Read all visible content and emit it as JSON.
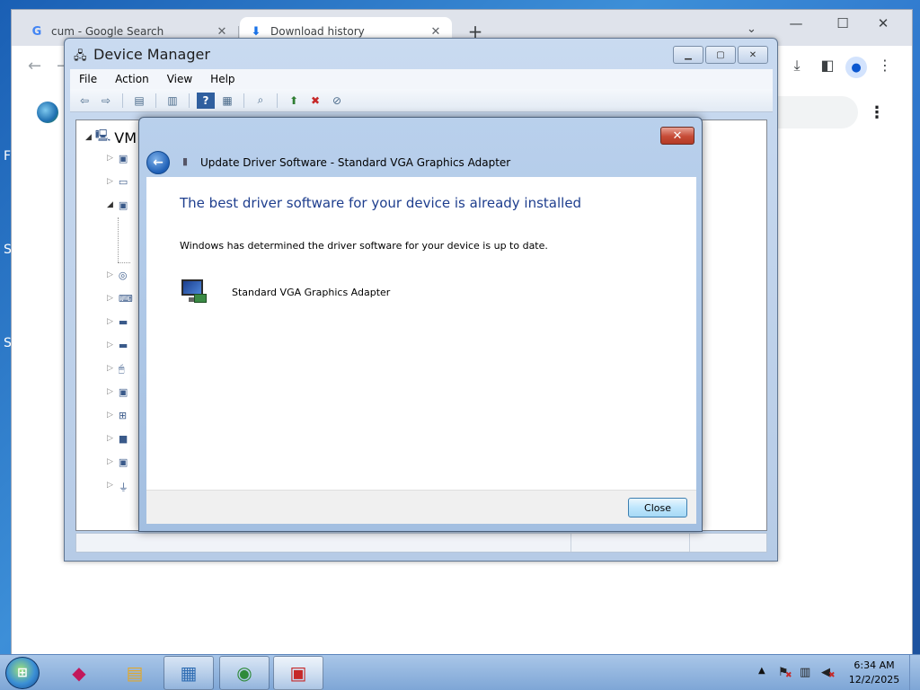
{
  "desktop": {
    "edge_letters": [
      "F",
      "S",
      "S"
    ]
  },
  "browser": {
    "tabs": [
      {
        "title": "cum - Google Search",
        "icon": "google-g-icon",
        "close": "✕",
        "active": false
      },
      {
        "title": "Download history",
        "icon": "download-icon",
        "close": "✕",
        "active": true
      }
    ],
    "new_tab": "+",
    "window_controls": {
      "minimize": "—",
      "maximize": "☐",
      "close": "✕"
    },
    "toolbar_icons": [
      "back-icon",
      "forward-icon",
      "download-icon",
      "side-panel-icon",
      "profile-icon",
      "more-vert-icon"
    ]
  },
  "device_manager": {
    "title": "Device Manager",
    "menus": [
      "File",
      "Action",
      "View",
      "Help"
    ],
    "tree_root": "VM",
    "toolbar_icons": [
      "back-icon",
      "forward-icon",
      "properties-icon",
      "show-hidden-icon",
      "help-icon",
      "view-icon",
      "scan-icon",
      "update-driver-icon",
      "uninstall-icon",
      "disable-icon"
    ]
  },
  "dialog": {
    "title": "Update Driver Software - Standard VGA Graphics Adapter",
    "heading": "The best driver software for your device is already installed",
    "message": "Windows has determined the driver software for your device is up to date.",
    "device_name": "Standard VGA Graphics Adapter",
    "close_button": "Close",
    "close_x": "✕"
  },
  "taskbar": {
    "items": [
      {
        "name": "app-launcher-icon",
        "glyph": "◆",
        "color": "#c2185b"
      },
      {
        "name": "file-explorer-icon",
        "glyph": "▤",
        "color": "#e0a82e"
      },
      {
        "name": "device-manager-icon",
        "glyph": "▦",
        "color": "#2f6db3",
        "running": true
      },
      {
        "name": "chrome-icon",
        "glyph": "◉",
        "color": "#2f8a3a",
        "running": true
      },
      {
        "name": "toolbox-icon",
        "glyph": "▣",
        "color": "#c62828",
        "running": true,
        "active": true
      }
    ],
    "clock_time": "6:34 AM",
    "clock_date": "12/2/2025"
  }
}
